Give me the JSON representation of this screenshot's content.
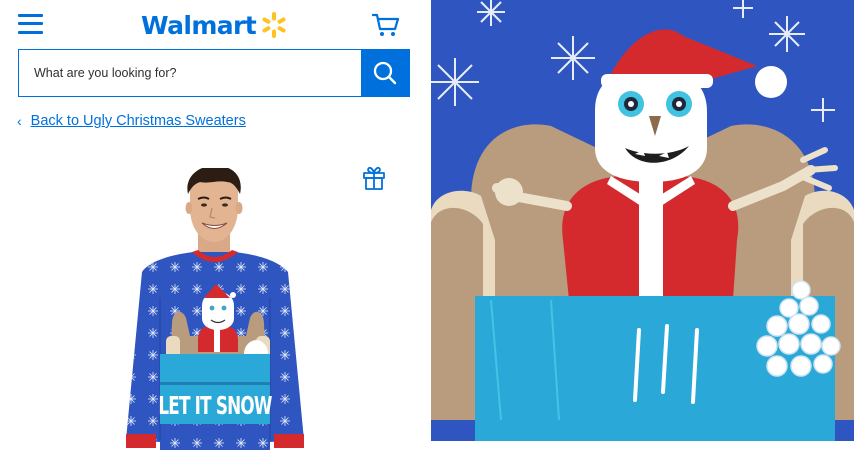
{
  "header": {
    "brand": "Walmart",
    "menu_icon": "hamburger-menu-icon",
    "logo_icon": "spark-icon",
    "cart_icon": "cart-icon"
  },
  "search": {
    "placeholder": "What are you looking for?",
    "icon": "search-icon"
  },
  "breadcrumb": {
    "chevron": "‹",
    "label": "Back to Ugly Christmas Sweaters"
  },
  "registry_icon": "gift-icon",
  "product": {
    "sweater_text": "LET IT SNOW"
  },
  "colors": {
    "walmart_blue": "#0071dc",
    "walmart_yellow": "#ffc220",
    "sweater_blue": "#2f56c0",
    "sweater_red": "#d42a2e",
    "table_cyan": "#2aa9d8"
  }
}
